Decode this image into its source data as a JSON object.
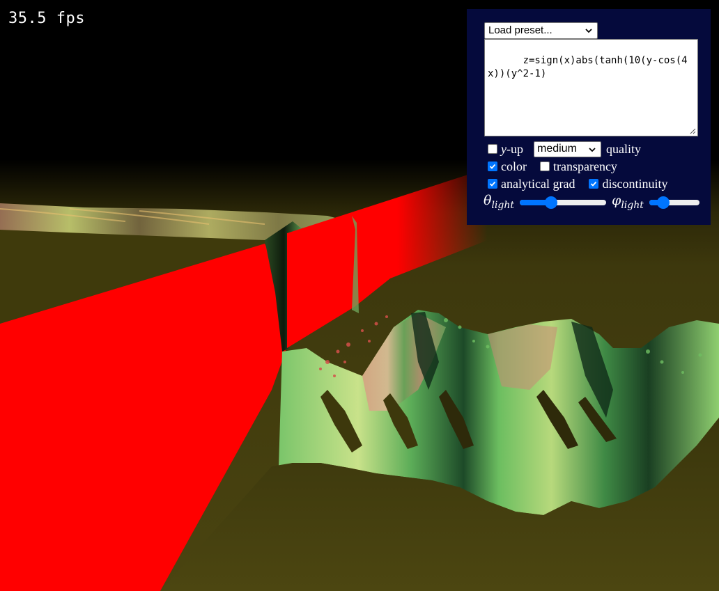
{
  "fps": "35.5 fps",
  "panel": {
    "preset_label": "Load preset...",
    "formula": "z=sign(x)abs(tanh(10(y-cos(4x))(y^2-1)",
    "y_up": {
      "label": "y",
      "suffix": "-up",
      "checked": false
    },
    "quality": {
      "selected": "medium",
      "label": "quality"
    },
    "color": {
      "label": "color",
      "checked": true
    },
    "transparency": {
      "label": "transparency",
      "checked": false
    },
    "analytical_grad": {
      "label": "analytical grad",
      "checked": true
    },
    "discontinuity": {
      "label": "discontinuity",
      "checked": true
    },
    "theta_light": {
      "symbol": "θ",
      "sub": "light",
      "value_fraction": 0.36
    },
    "phi_light": {
      "symbol": "φ",
      "sub": "light",
      "value_fraction": 0.28
    }
  },
  "colors": {
    "panel_bg": "#050a3c",
    "accent": "#0075ff",
    "wall_red": "#ff0000",
    "ground_olive": "#454010",
    "surface_green": "#6fbf62",
    "surface_pink": "#d18a78"
  },
  "icons": {
    "preset_chevron": "chevron-down-icon",
    "quality_chevron": "chevron-down-icon",
    "resize_grip": "resize-grip-icon",
    "check": "checkmark-icon"
  }
}
